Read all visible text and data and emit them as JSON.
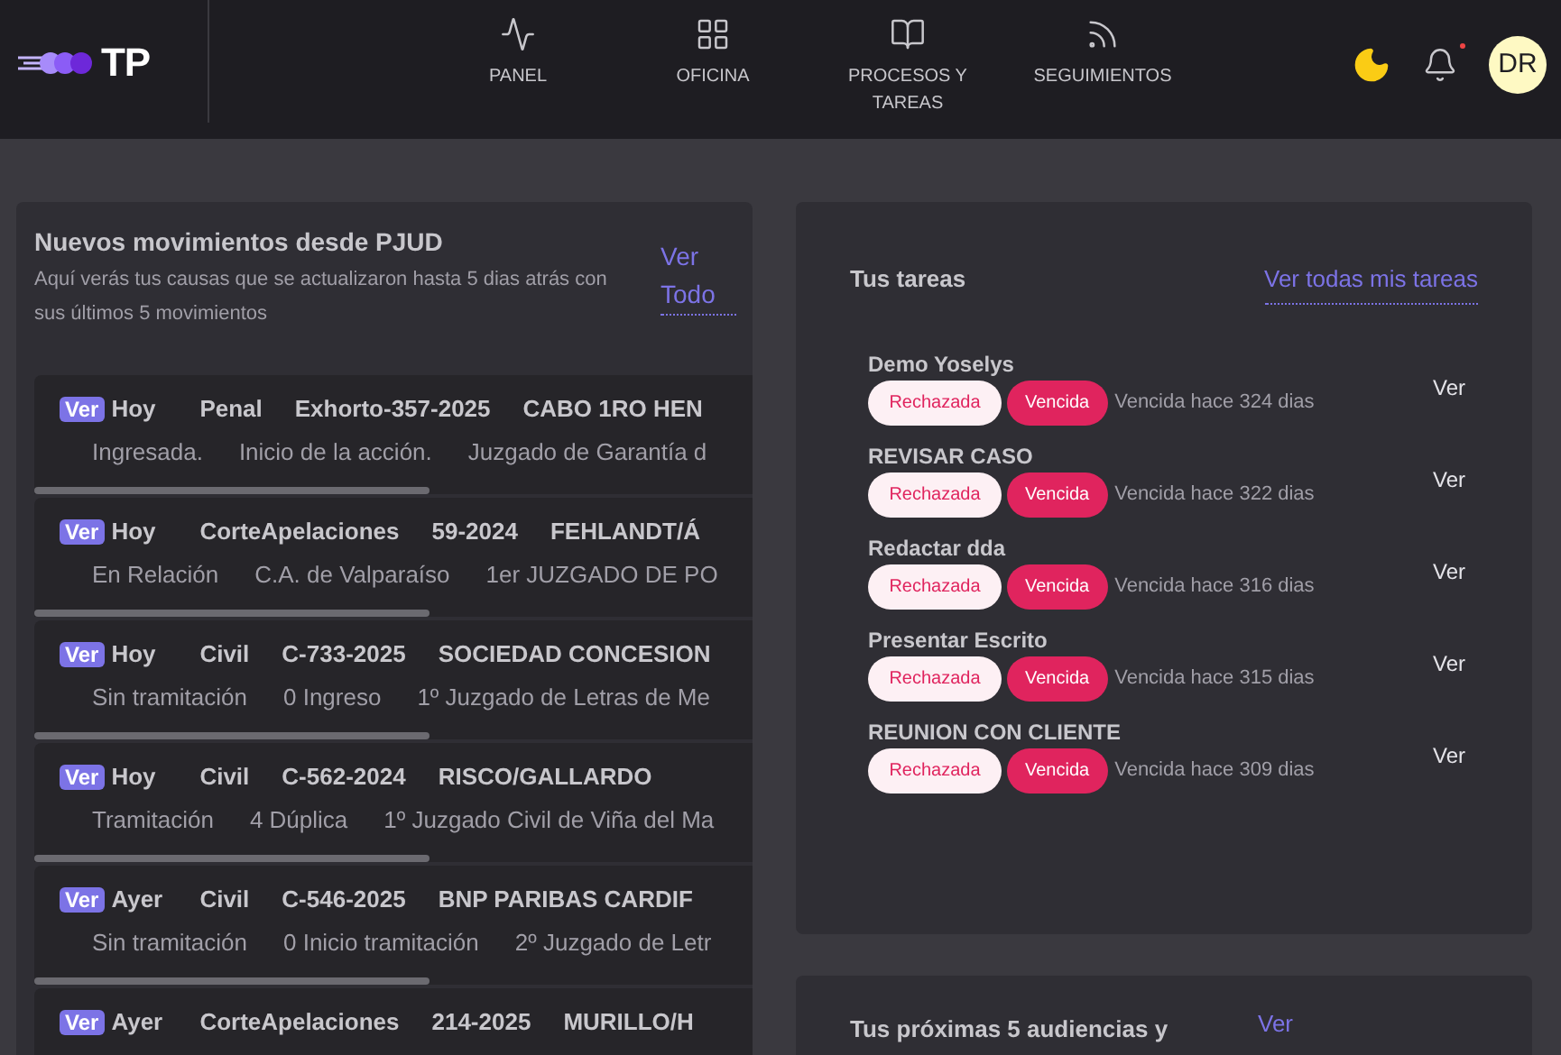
{
  "header": {
    "logo": "TP",
    "nav": [
      {
        "label": "PANEL",
        "selected": false
      },
      {
        "label": "OFICINA",
        "selected": false
      },
      {
        "label": "PROCESOS Y TAREAS",
        "selected": false
      },
      {
        "label": "SEGUIMIENTOS",
        "selected": false
      }
    ],
    "avatar": "DR",
    "notification_dot": true
  },
  "movements": {
    "title": "Nuevos movimientos desde PJUD",
    "subtitle": "Aquí verás tus causas que se actualizaron hasta 5 dias atrás con sus últimos 5 movimientos",
    "link": "Ver Todo",
    "rows": [
      {
        "badge": "Ver",
        "day": "Hoy",
        "type": "Penal",
        "rol": "Exhorto-357-2025",
        "name": "CABO 1RO HEN",
        "details": [
          "Ingresada.",
          "Inicio de la acción.",
          "Juzgado de Garantía d"
        ]
      },
      {
        "badge": "Ver",
        "day": "Hoy",
        "type": "CorteApelaciones",
        "rol": "59-2024",
        "name": "FEHLANDT/Á",
        "details": [
          "En Relación",
          "C.A. de Valparaíso",
          "1er JUZGADO DE PO"
        ]
      },
      {
        "badge": "Ver",
        "day": "Hoy",
        "type": "Civil",
        "rol": "C-733-2025",
        "name": "SOCIEDAD CONCESION",
        "details": [
          "Sin tramitación",
          "0 Ingreso",
          "1º Juzgado de Letras de Me"
        ]
      },
      {
        "badge": "Ver",
        "day": "Hoy",
        "type": "Civil",
        "rol": "C-562-2024",
        "name": "RISCO/GALLARDO",
        "details": [
          "Tramitación",
          "4 Dúplica",
          "1º Juzgado Civil de Viña del Ma"
        ]
      },
      {
        "badge": "Ver",
        "day": "Ayer",
        "type": "Civil",
        "rol": "C-546-2025",
        "name": "BNP PARIBAS CARDIF",
        "details": [
          "Sin tramitación",
          "0 Inicio tramitación",
          "2º Juzgado de Letr"
        ]
      },
      {
        "badge": "Ver",
        "day": "Ayer",
        "type": "CorteApelaciones",
        "rol": "214-2025",
        "name": "MURILLO/H",
        "details": []
      }
    ]
  },
  "tasks": {
    "title": "Tus tareas",
    "link": "Ver todas mis tareas",
    "items": [
      {
        "name": "Demo Yoselys",
        "tags": [
          "Rechazada",
          "Vencida"
        ],
        "due": "Vencida hace 324 dias",
        "action": "Ver"
      },
      {
        "name": "REVISAR CASO",
        "tags": [
          "Rechazada",
          "Vencida"
        ],
        "due": "Vencida hace 322 dias",
        "action": "Ver"
      },
      {
        "name": "Redactar dda",
        "tags": [
          "Rechazada",
          "Vencida"
        ],
        "due": "Vencida hace 316 dias",
        "action": "Ver"
      },
      {
        "name": "Presentar Escrito",
        "tags": [
          "Rechazada",
          "Vencida"
        ],
        "due": "Vencida hace 315 dias",
        "action": "Ver"
      },
      {
        "name": "REUNION CON CLIENTE",
        "tags": [
          "Rechazada",
          "Vencida"
        ],
        "due": "Vencida hace 309 dias",
        "action": "Ver"
      }
    ]
  },
  "hearings": {
    "title": "Tus próximas 5 audiencias y",
    "link": "Ver"
  }
}
